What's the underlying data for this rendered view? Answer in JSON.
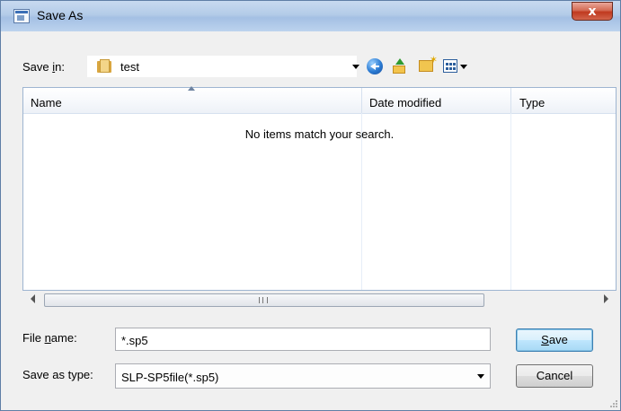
{
  "window": {
    "title": "Save As",
    "close_label": "x"
  },
  "toolbar": {
    "save_in_label_pre": "Save ",
    "save_in_label_u": "i",
    "save_in_label_post": "n:",
    "current_folder": "test"
  },
  "list": {
    "columns": [
      "Name",
      "Date modified",
      "Type"
    ],
    "empty_message": "No items match your search."
  },
  "scroll": {
    "grip_text": "III"
  },
  "form": {
    "filename_label_pre": "File ",
    "filename_label_u": "n",
    "filename_label_post": "ame:",
    "filename_value": "*.sp5",
    "type_label": "Save as type:",
    "type_value": "SLP-SP5file(*.sp5)"
  },
  "buttons": {
    "save_u": "S",
    "save_rest": "ave",
    "cancel": "Cancel"
  }
}
